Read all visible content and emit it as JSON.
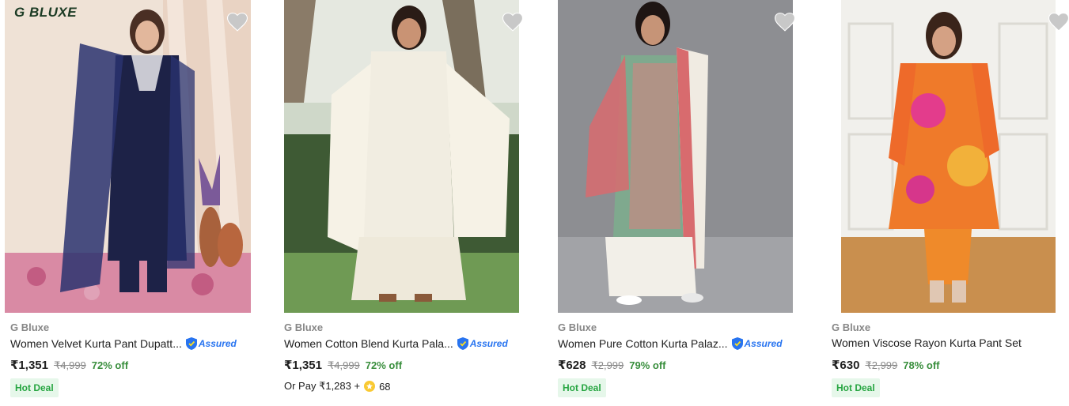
{
  "products": [
    {
      "brand_logo": "G BLUXE",
      "brand": "G Bluxe",
      "title": "Women Velvet Kurta Pant Dupatt...",
      "assured": "Assured",
      "price": "₹1,351",
      "mrp": "₹4,999",
      "discount": "72% off",
      "deal": "Hot Deal",
      "wishlist_icon": "heart-icon"
    },
    {
      "brand": "G Bluxe",
      "title": "Women Cotton Blend Kurta Pala...",
      "assured": "Assured",
      "price": "₹1,351",
      "mrp": "₹4,999",
      "discount": "72% off",
      "orpay_text": "Or Pay ₹1,283 +",
      "orpay_coins": "68",
      "wishlist_icon": "heart-icon"
    },
    {
      "brand": "G Bluxe",
      "title": "Women Pure Cotton Kurta Palaz...",
      "assured": "Assured",
      "price": "₹628",
      "mrp": "₹2,999",
      "discount": "79% off",
      "deal": "Hot Deal",
      "wishlist_icon": "heart-icon"
    },
    {
      "brand": "G Bluxe",
      "title": "Women Viscose Rayon Kurta Pant Set",
      "price": "₹630",
      "mrp": "₹2,999",
      "discount": "78% off",
      "deal": "Hot Deal",
      "wishlist_icon": "heart-icon"
    }
  ],
  "colors": {
    "price_off": "#388e3c",
    "assured_blue": "#2874f0",
    "deal_bg": "#e6f7ea",
    "deal_text": "#26a541",
    "heart": "#c8c8c8"
  }
}
